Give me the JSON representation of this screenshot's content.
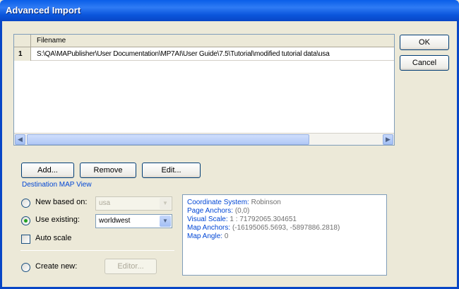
{
  "window": {
    "title": "Advanced Import"
  },
  "grid": {
    "header_filename": "Filename",
    "rows": [
      {
        "num": "1",
        "filename": "S:\\QA\\MAPublisher\\User Documentation\\MP7AI\\User Guide\\7.5\\Tutorial\\modified tutorial data\\usa"
      }
    ]
  },
  "buttons": {
    "ok": "OK",
    "cancel": "Cancel",
    "add": "Add...",
    "remove": "Remove",
    "edit": "Edit...",
    "editor": "Editor..."
  },
  "destination": {
    "group_label": "Destination MAP View",
    "new_based_on_label": "New based on:",
    "new_based_on_value": "usa",
    "use_existing_label": "Use existing:",
    "use_existing_value": "worldwest",
    "auto_scale_label": "Auto scale",
    "create_new_label": "Create new:",
    "selected": "use_existing"
  },
  "info": {
    "coordinate_system_key": "Coordinate System:",
    "coordinate_system_val": "Robinson",
    "page_anchors_key": "Page Anchors:",
    "page_anchors_val": "(0,0)",
    "visual_scale_key": "Visual Scale:",
    "visual_scale_val": "1 : 71792065.304651",
    "map_anchors_key": "Map Anchors:",
    "map_anchors_val": "(-16195065.5693, -5897886.2818)",
    "map_angle_key": "Map Angle:",
    "map_angle_val": "0"
  },
  "icons": {
    "scroll_left": "scroll-left-arrow-icon",
    "scroll_right": "scroll-right-arrow-icon",
    "dropdown": "chevron-down-icon"
  }
}
